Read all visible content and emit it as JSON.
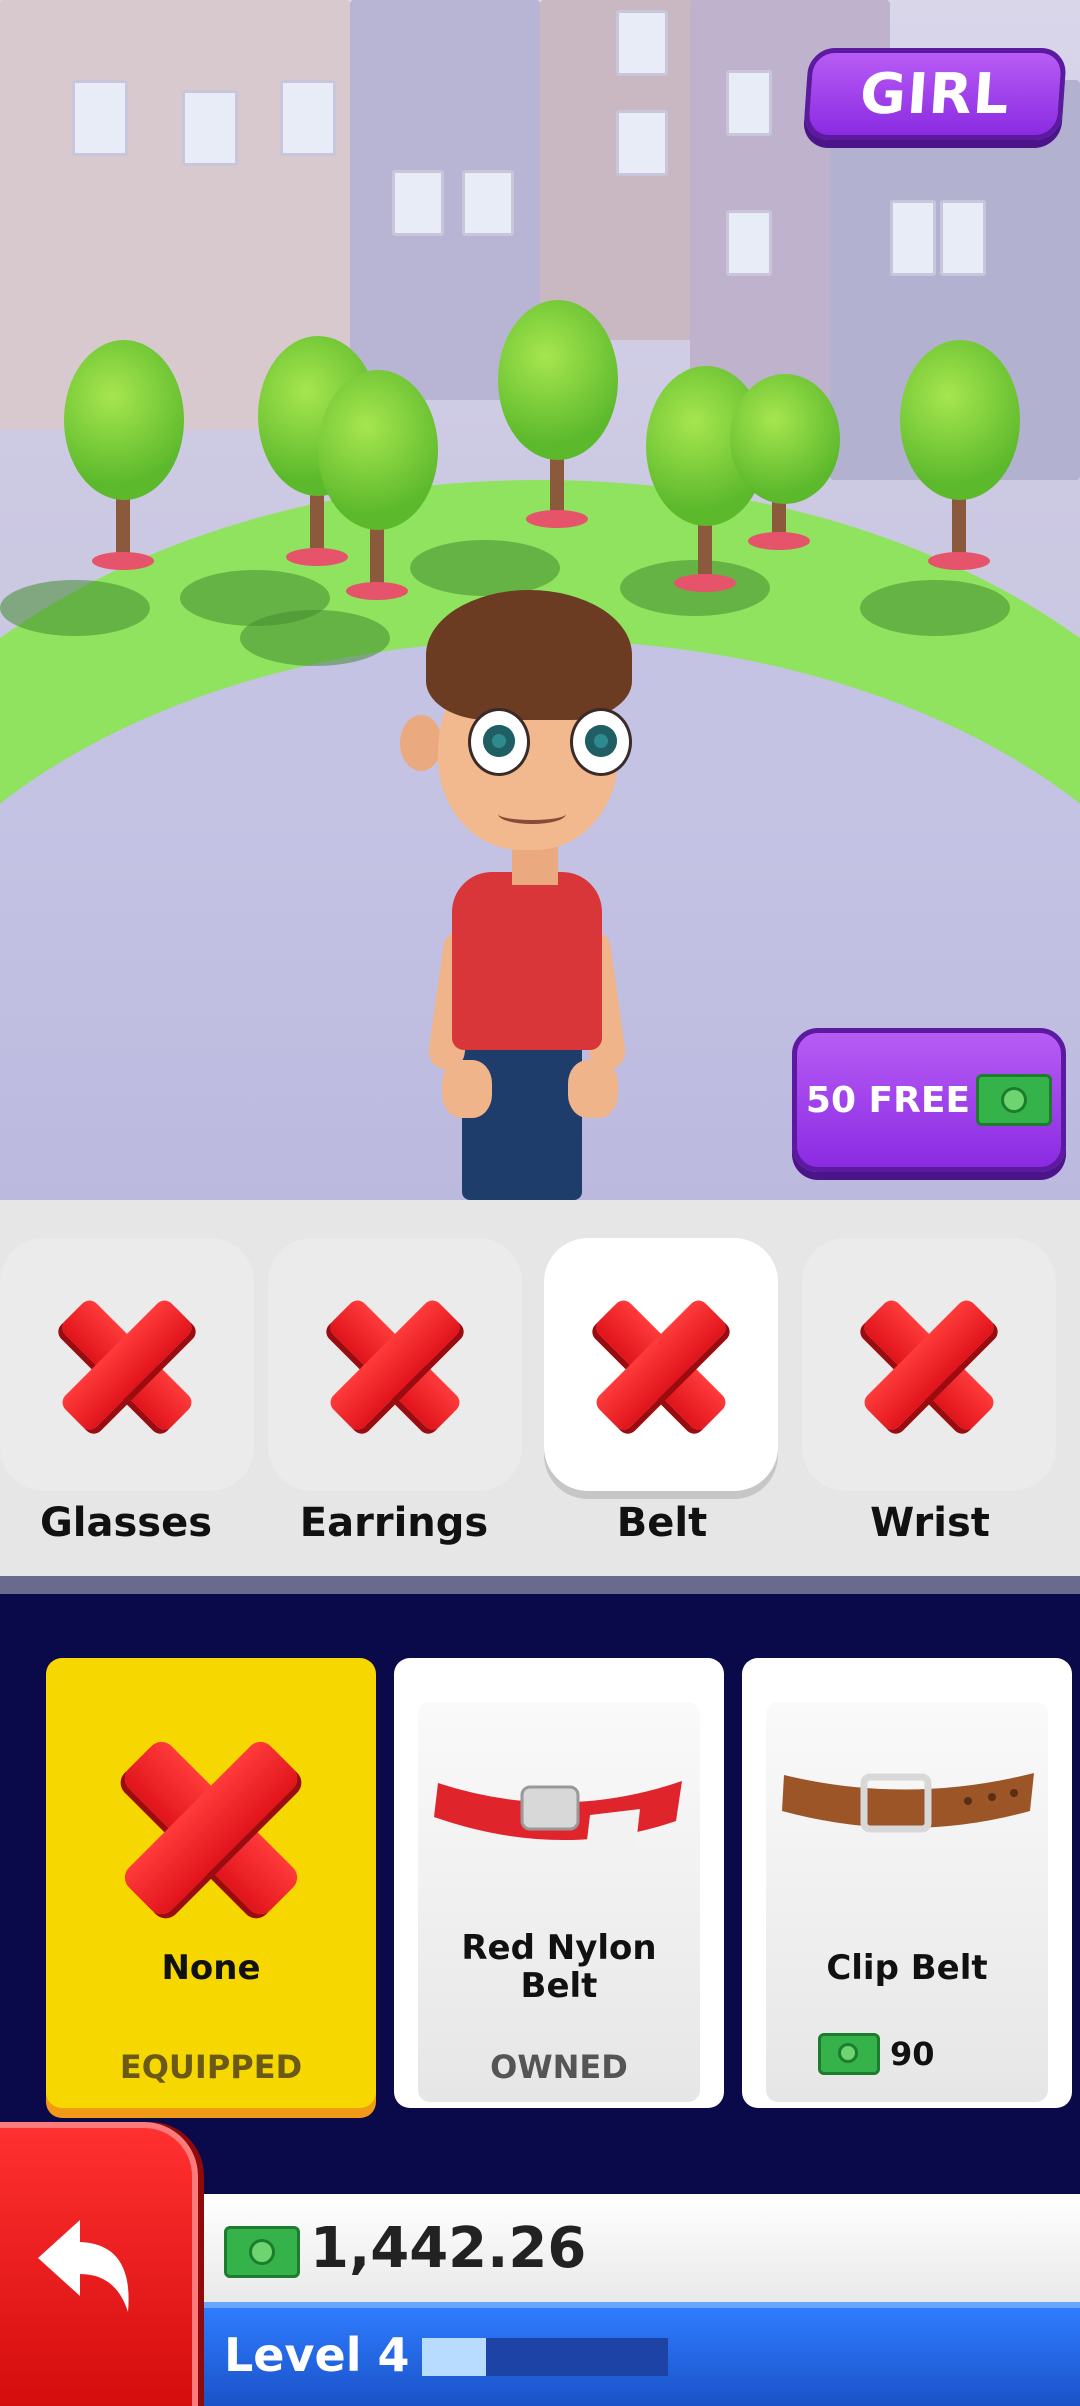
{
  "scene": {
    "gender_button": "GIRL",
    "free_button": {
      "label": "50 FREE",
      "icon": "cash-icon"
    }
  },
  "categories": [
    {
      "label": "Glasses",
      "icon": "red-x-icon",
      "active": false
    },
    {
      "label": "Earrings",
      "icon": "red-x-icon",
      "active": false
    },
    {
      "label": "Belt",
      "icon": "red-x-icon",
      "active": true
    },
    {
      "label": "Wrist",
      "icon": "red-x-icon",
      "active": false
    }
  ],
  "items": [
    {
      "name": "None",
      "status": "EQUIPPED",
      "icon": "red-x-icon"
    },
    {
      "name_line1": "Red Nylon",
      "name_line2": "Belt",
      "status": "OWNED",
      "icon": "red-nylon-belt-icon"
    },
    {
      "name": "Clip Belt",
      "price": "90",
      "icon": "clip-belt-icon"
    }
  ],
  "hud": {
    "money": "1,442.26",
    "level": "Level 4",
    "level_progress": 0.26
  },
  "colors": {
    "accent_purple": "#8b2be2",
    "equipped_yellow": "#f6d800",
    "cash_green": "#36b24a",
    "level_blue": "#2f7cff",
    "back_red": "#e0141b"
  }
}
